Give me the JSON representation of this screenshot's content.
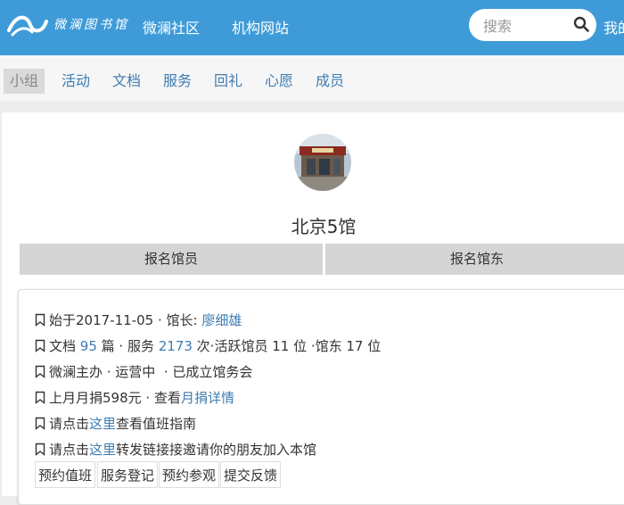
{
  "header": {
    "logo_text": "微澜图书馆",
    "nav": [
      "微澜社区",
      "机构网站"
    ],
    "search_placeholder": "搜索",
    "user_link": "我的"
  },
  "tabs": [
    "小组",
    "活动",
    "文档",
    "服务",
    "回礼",
    "心愿",
    "成员"
  ],
  "active_tab": "小组",
  "hall": {
    "name": "北京5馆",
    "join_member_button": "报名馆员",
    "join_owner_button": "报名馆东"
  },
  "info": {
    "founded_prefix": "始于",
    "founded_date": "2017-11-05",
    "director_prefix": " · 馆长: ",
    "director": "廖细雄",
    "docs_prefix": "文档 ",
    "docs_count": "95",
    "docs_mid": " 篇 · 服务 ",
    "service_count": "2173",
    "docs_suffix": " 次·活跃馆员 11 位 ·馆东 17 位",
    "status": "微澜主办 · 运营中  · 已成立馆务会",
    "donation_prefix": "上月月捐598元 · 查看",
    "donation_link": "月捐详情",
    "duty_prefix": "请点击",
    "duty_link": "这里",
    "duty_suffix": "查看值班指南",
    "invite_prefix": "请点击",
    "invite_link": "这里",
    "invite_suffix": "转发链接接邀请你的朋友加入本馆"
  },
  "actions": [
    "预约值班",
    "服务登记",
    "预约参观",
    "提交反馈"
  ],
  "colors": {
    "header_bg": "#3e9bd8",
    "link": "#3e7cb1",
    "page_bg": "#ececec"
  }
}
